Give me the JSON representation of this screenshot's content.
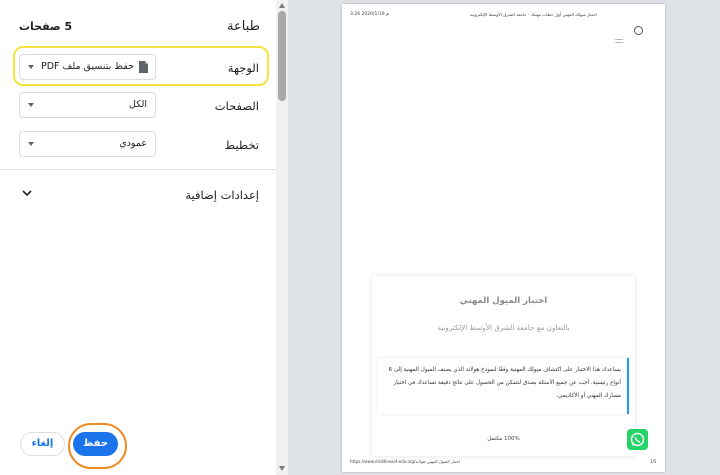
{
  "dialog": {
    "title": "طباعة",
    "pages_count": "5 صفحات"
  },
  "settings": {
    "destination": {
      "label": "الوجهة",
      "value": "حفظ بتنسيق ملف PDF"
    },
    "pages": {
      "label": "الصفحات",
      "value": "الكل"
    },
    "layout": {
      "label": "تخطيط",
      "value": "عمودي"
    },
    "more_settings": {
      "label": "إعدادات إضافية"
    }
  },
  "buttons": {
    "save": "حفظ",
    "cancel": "إلغاء"
  },
  "preview": {
    "header_left": "3:26 2020/1/19 م",
    "header_center": "اختبار ميولك المهني أول خطاب مهنتك - جامعة الشرق الأوسط الإلكترونية",
    "card_title": "اختبار الميول المهني",
    "card_subtitle": "بالتعاون مع جامعة الشرق الأوسط الإلكترونية",
    "card_text": "يساعدك هذا الاختبار على اكتشاف ميولك المهنية وفقًا لنموذج هولاند الذي يصنف الميول المهنية إلى 6 أنواع رئيسية. أجب عن جميع الأسئلة بصدق لتتمكن من الحصول على نتائج دقيقة تساعدك في اختيار مسارك المهني أو الأكاديمي.",
    "progress": "100% مكتمل",
    "footer_left": "https://www.middleeast-edu.org/اختبار الميول المهني-هولاند",
    "footer_right": "1/5"
  },
  "colors": {
    "primary": "#1a73e8",
    "highlight_yellow": "#f5e43c",
    "highlight_orange": "#f08a24",
    "whatsapp": "#25d366"
  }
}
